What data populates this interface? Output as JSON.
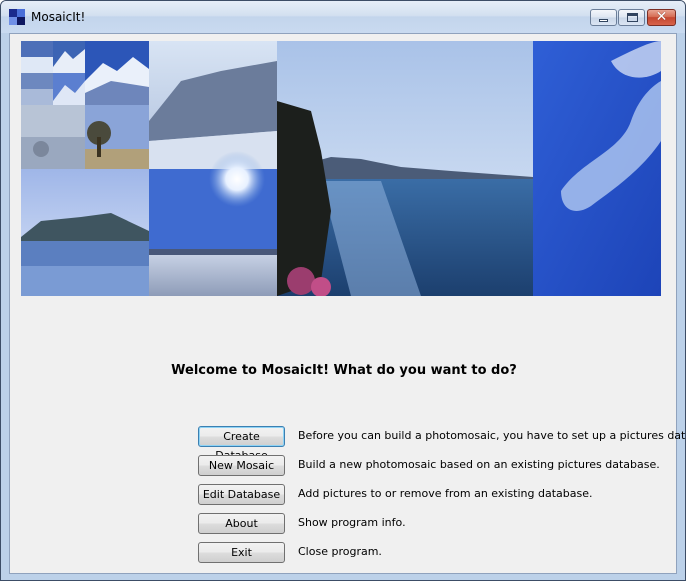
{
  "window": {
    "title": "MosaicIt!",
    "controls": [
      "minimize",
      "maximize",
      "close"
    ],
    "close_glyph": "✕"
  },
  "banner": {
    "description_icons": [
      "mountain-snow-photo",
      "lake-photo",
      "sunset-sea-photo",
      "sky-cloud-photo"
    ]
  },
  "welcome": "Welcome to MosaicIt! What do you want to do?",
  "actions": [
    {
      "label": "Create Database",
      "description": "Before you can build a photomosaic, you have to set up a pictures database.",
      "default": true
    },
    {
      "label": "New Mosaic",
      "description": "Build a new photomosaic based on an existing pictures database."
    },
    {
      "label": "Edit Database",
      "description": "Add pictures to or remove from an existing database."
    },
    {
      "label": "About",
      "description": "Show program info."
    },
    {
      "label": "Exit",
      "description": "Close program."
    }
  ]
}
